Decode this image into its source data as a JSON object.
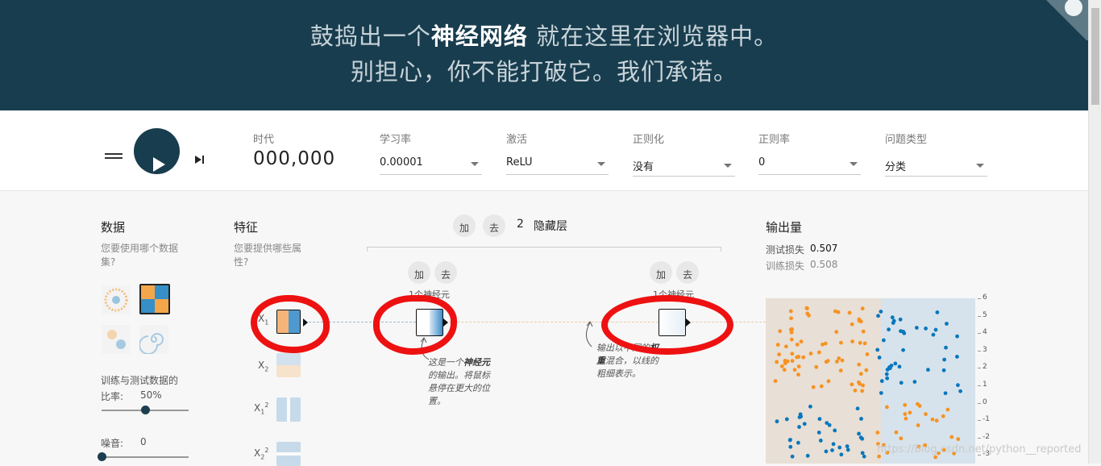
{
  "header": {
    "line1_pre": "鼓捣出一个",
    "line1_bold": "神经网络",
    "line1_post": " 就在这里在浏览器中。",
    "line2": "别担心，你不能打破它。我们承诺。"
  },
  "controls": {
    "epoch_label": "时代",
    "epoch_value": "000,000",
    "learning_rate_label": "学习率",
    "learning_rate_value": "0.00001",
    "activation_label": "激活",
    "activation_value": "ReLU",
    "regularization_label": "正则化",
    "regularization_value": "没有",
    "reg_rate_label": "正则率",
    "reg_rate_value": "0",
    "problem_label": "问题类型",
    "problem_value": "分类"
  },
  "data_panel": {
    "title": "数据",
    "subtitle_1": "您要使用哪个数据",
    "subtitle_2": "集?",
    "ratio_label_1": "训练与测试数据的",
    "ratio_label_2": "比率:",
    "ratio_value": "50%",
    "ratio_fraction": 0.5,
    "noise_label": "噪音:",
    "noise_value": "0",
    "noise_fraction": 0.0
  },
  "features_panel": {
    "title": "特征",
    "subtitle_1": "您要提供哪些属",
    "subtitle_2": "性?"
  },
  "network": {
    "add_label": "加",
    "remove_label": "去",
    "hidden_count": "2",
    "hidden_label": "隐藏层",
    "layer1_neurons": "1个神经元",
    "layer2_neurons": "1个神经元",
    "annotation1": [
      "这是一个",
      "神经元",
      "的输出。将鼠标",
      "悬停在更大的位",
      "置。"
    ],
    "annotation2": [
      "输出以不同的",
      "权",
      "重",
      "混合，以线的",
      "粗细表示。"
    ]
  },
  "output_panel": {
    "title": "输出量",
    "test_loss_label": "测试损失",
    "test_loss_value": "0.507",
    "train_loss_label": "训练损失",
    "train_loss_value": "0.508",
    "y_ticks": [
      "6",
      "5",
      "4",
      "3",
      "2",
      "1",
      "0",
      "-1",
      "-2",
      "-3"
    ]
  },
  "colors": {
    "header_bg": "#183d4e",
    "orange": "#f59322",
    "blue": "#0877bd",
    "annotation_red": "#ee1111"
  },
  "watermark": "https://blog.csdn.net/python__reported"
}
